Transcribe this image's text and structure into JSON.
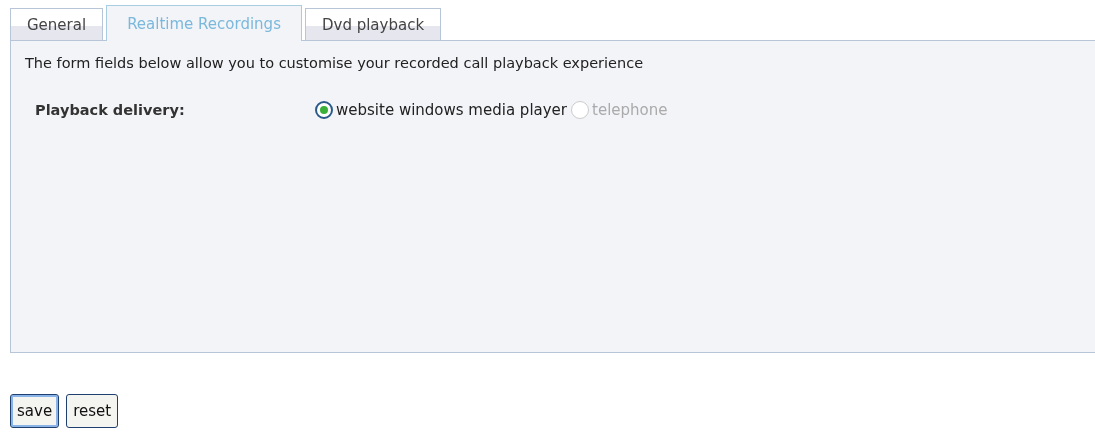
{
  "tabs": [
    {
      "label": "General",
      "selected": false
    },
    {
      "label": "Realtime Recordings",
      "selected": true
    },
    {
      "label": "Dvd playback",
      "selected": false
    }
  ],
  "intro": "The form fields below allow you to customise your recorded call playback experience",
  "playback_delivery": {
    "label": "Playback delivery:",
    "options": [
      {
        "label": "website windows media player",
        "selected": true,
        "disabled": false
      },
      {
        "label": "telephone",
        "selected": false,
        "disabled": true
      }
    ]
  },
  "buttons": [
    {
      "label": "save",
      "focused": true
    },
    {
      "label": "reset",
      "focused": false
    }
  ]
}
